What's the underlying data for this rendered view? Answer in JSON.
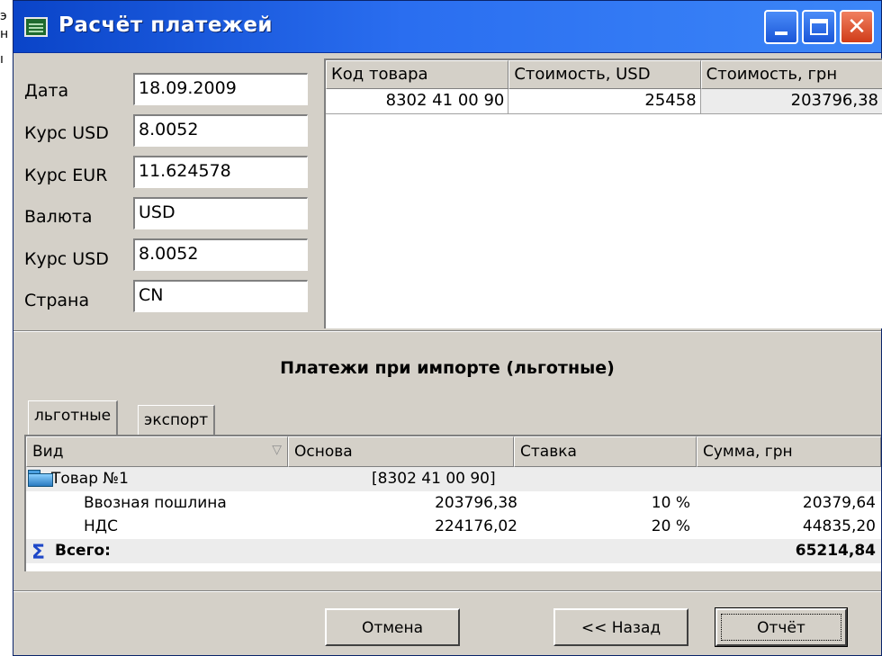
{
  "window": {
    "title": "Расчёт платежей"
  },
  "form": {
    "fields": [
      {
        "label": "Дата",
        "value": "18.09.2009"
      },
      {
        "label": "Курс USD",
        "value": "8.0052"
      },
      {
        "label": "Курс EUR",
        "value": "11.624578"
      },
      {
        "label": "Валюта",
        "value": "USD"
      },
      {
        "label": "Курс USD",
        "value": "8.0052"
      },
      {
        "label": "Страна",
        "value": "CN"
      }
    ]
  },
  "goods_table": {
    "columns": [
      "Код товара",
      "Стоимость, USD",
      "Стоимость, грн"
    ],
    "rows": [
      [
        "8302 41 00 90",
        "25458",
        "203796,38"
      ]
    ]
  },
  "payments": {
    "heading": "Платежи при импорте (льготные)",
    "tabs": [
      "льготные",
      "экспорт"
    ],
    "columns": [
      "Вид",
      "Основа",
      "Ставка",
      "Сумма, грн"
    ],
    "group": {
      "name": "Товар №1",
      "code": "[8302 41 00 90]"
    },
    "items": [
      {
        "name": "Ввозная пошлина",
        "base": "203796,38",
        "rate": "10 %",
        "sum": "20379,64"
      },
      {
        "name": "НДС",
        "base": "224176,02",
        "rate": "20 %",
        "sum": "44835,20"
      }
    ],
    "total": {
      "label": "Всего:",
      "sum": "65214,84"
    }
  },
  "buttons": {
    "cancel": "Отмена",
    "back": "<< Назад",
    "report": "Отчёт"
  },
  "icons": {
    "app": "calculator-grid-icon",
    "sort": "sort-down-icon",
    "folder": "folder-icon",
    "sum": "sigma-icon"
  }
}
